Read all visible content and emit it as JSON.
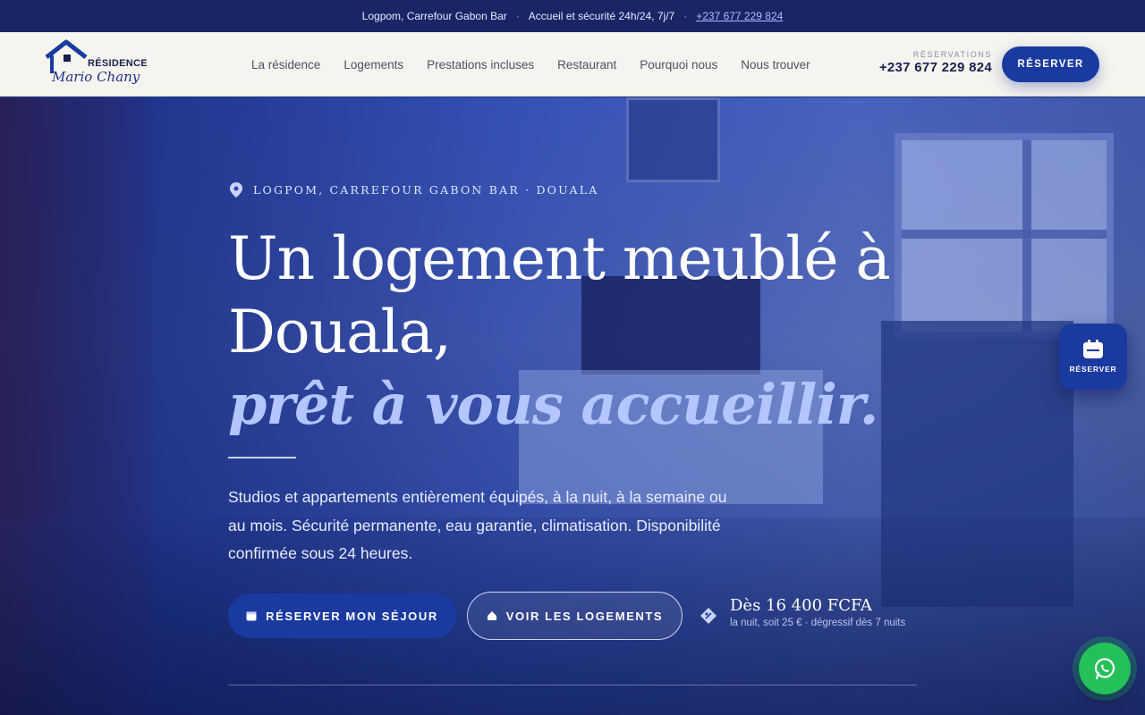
{
  "topbar": {
    "address": "Logpom, Carrefour Gabon Bar",
    "sep1": "·",
    "hours": "Accueil et sécurité 24h/24, 7j/7",
    "sep2": "·",
    "phone": "+237 677 229 824"
  },
  "header": {
    "logo_line1": "RÉSIDENCE",
    "logo_line2": "Mario Chany",
    "nav": [
      "La résidence",
      "Logements",
      "Prestations incluses",
      "Restaurant",
      "Pourquoi nous",
      "Nous trouver"
    ],
    "reservations_label": "RÉSERVATIONS",
    "reservations_phone": "+237 677 229 824",
    "cta": "RÉSERVER"
  },
  "hero": {
    "location": "LOGPOM, CARREFOUR GABON BAR · DOUALA",
    "title_line1": "Un logement meublé à",
    "title_line2": "Douala,",
    "title_accent": "prêt à vous accueillir.",
    "lead": "Studios et appartements entièrement équipés, à la nuit, à la semaine ou au mois. Sécurité permanente, eau garantie, climatisation. Disponibilité confirmée sous 24 heures.",
    "btn_primary": "RÉSERVER MON SÉJOUR",
    "btn_secondary": "VOIR LES LOGEMENTS",
    "price": "Dès 16 400 FCFA",
    "price_sub": "la nuit, soit 25 € · dégressif dès 7 nuits"
  },
  "floating": {
    "reserve_label": "RÉSERVER"
  },
  "colors": {
    "navy": "#1a2566",
    "primary": "#1b3aa0",
    "accent_text": "#b3c6ff",
    "whatsapp": "#25c05a"
  },
  "icons": [
    "house-logo-icon",
    "location-pin-icon",
    "calendar-icon",
    "home-icon",
    "price-tag-icon",
    "whatsapp-icon"
  ]
}
